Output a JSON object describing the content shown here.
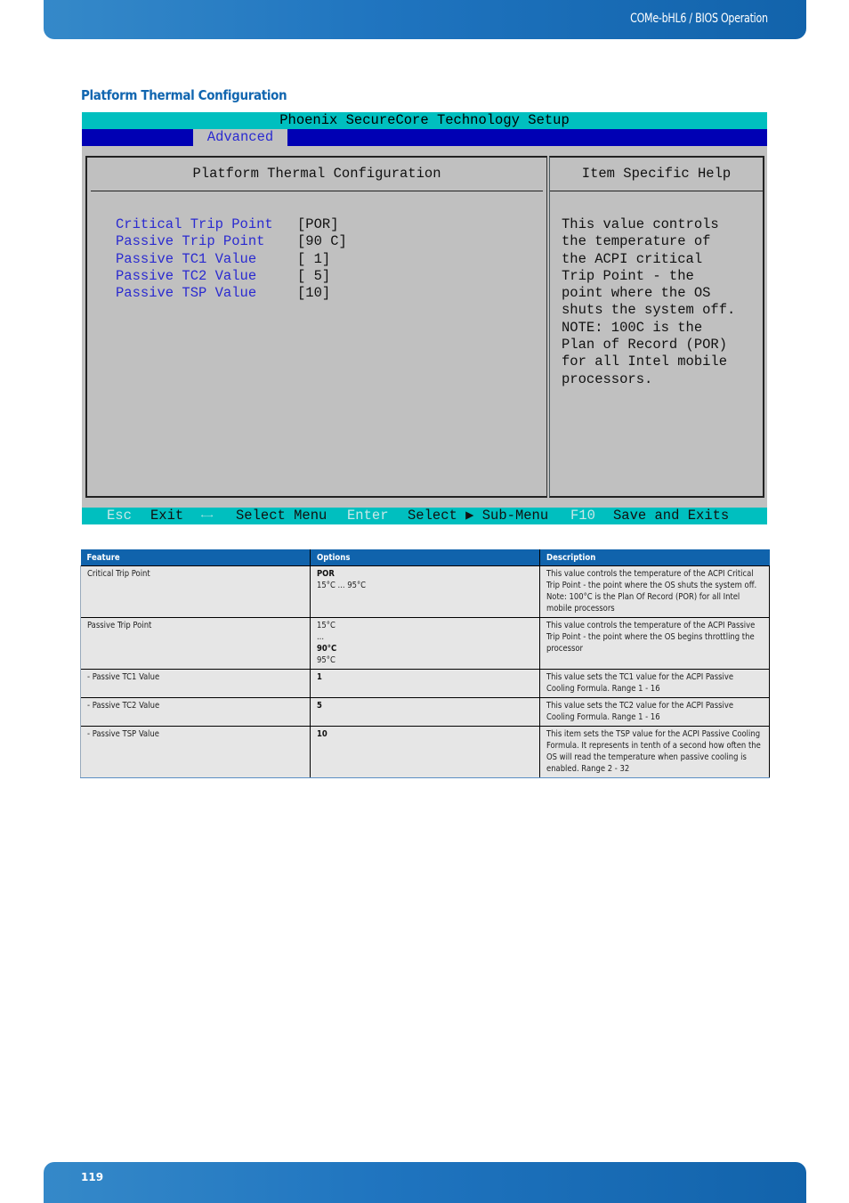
{
  "header": {
    "title": "COMe-bHL6 / BIOS Operation"
  },
  "section": {
    "title": "Platform Thermal Configuration"
  },
  "bios": {
    "title": "Phoenix SecureCore Technology Setup",
    "active_tab": "Advanced",
    "main_panel_title": "Platform Thermal Configuration",
    "help_panel_title": "Item Specific Help",
    "items": [
      {
        "label": "Critical Trip Point",
        "value": "[POR]"
      },
      {
        "label": "Passive Trip Point",
        "value": "[90 C]"
      },
      {
        "label": "Passive TC1 Value",
        "value": "[ 1]"
      },
      {
        "label": "Passive TC2 Value",
        "value": "[ 5]"
      },
      {
        "label": "Passive TSP Value",
        "value": "[10]"
      }
    ],
    "help_text": "This value controls\nthe temperature of\nthe ACPI critical\nTrip Point - the\npoint where the OS\nshuts the system off.\nNOTE: 100C is the\nPlan of Record (POR)\nfor all Intel mobile\nprocessors.",
    "key_bar": {
      "esc_key": "Esc",
      "esc_label": "Exit",
      "arrows_key": "←→",
      "arrows_label": "Select Menu",
      "enter_key": "Enter",
      "enter_label": "Select ▶ Sub-Menu",
      "f10_key": "F10",
      "f10_label": "Save and Exits"
    }
  },
  "table": {
    "headers": [
      "Feature",
      "Options",
      "Description"
    ],
    "rows": [
      {
        "feature": "Critical Trip Point",
        "options": [
          {
            "text": "POR",
            "bold": true
          },
          {
            "text": "15°C ... 95°C",
            "bold": false
          }
        ],
        "description": "This value controls the temperature of the ACPI Critical Trip Point - the point where the OS shuts the system off. Note: 100°C is the Plan Of Record (POR) for all Intel mobile processors"
      },
      {
        "feature": "Passive Trip Point",
        "options": [
          {
            "text": "15°C",
            "bold": false
          },
          {
            "text": "...",
            "bold": false
          },
          {
            "text": "90°C",
            "bold": true
          },
          {
            "text": "95°C",
            "bold": false
          }
        ],
        "description": "This value controls the temperature of the ACPI Passive Trip Point - the point where the OS begins throttling the processor"
      },
      {
        "feature": "- Passive TC1 Value",
        "options": [
          {
            "text": "1",
            "bold": true
          }
        ],
        "description": "This value sets the TC1 value for the ACPI Passive Cooling Formula. Range 1 - 16"
      },
      {
        "feature": "- Passive TC2 Value",
        "options": [
          {
            "text": "5",
            "bold": true
          }
        ],
        "description": "This value sets the TC2 value for the ACPI Passive Cooling Formula. Range 1 - 16"
      },
      {
        "feature": "- Passive TSP Value",
        "options": [
          {
            "text": "10",
            "bold": true
          }
        ],
        "description": "This item sets the TSP value for the ACPI Passive Cooling Formula. It represents in tenth of a second how often the OS will read the temperature when passive cooling is enabled. Range 2 - 32"
      }
    ]
  },
  "footer": {
    "page_number": "119"
  }
}
